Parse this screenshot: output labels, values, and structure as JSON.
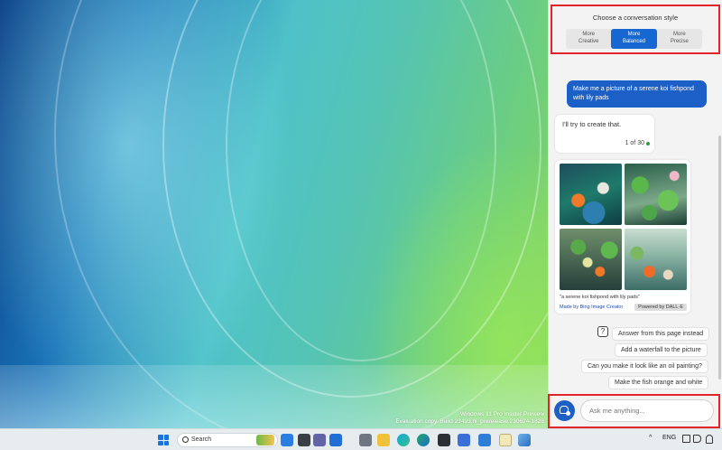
{
  "desktop": {
    "watermark_line1": "Windows 11 Pro Insider Preview",
    "watermark_line2": "Evaluation copy. Build 23493.ni_prerelease.230624-1828"
  },
  "copilot": {
    "style_title": "Choose a conversation style",
    "styles": [
      {
        "line1": "More",
        "line2": "Creative",
        "active": false
      },
      {
        "line1": "More",
        "line2": "Balanced",
        "active": true
      },
      {
        "line1": "More",
        "line2": "Precise",
        "active": false
      }
    ],
    "user_message": "Make me a picture of a serene koi fishpond with lily pads",
    "bot_reply": "I'll try to create that.",
    "turn_counter": "1 of 30",
    "image_card": {
      "caption": "\"a serene koi fishpond with lily pads\"",
      "made_by": "Made by Bing Image Creator",
      "powered_by": "Powered by DALL·E"
    },
    "suggestions": [
      "Answer from this page instead",
      "Add a waterfall to the picture",
      "Can you make it look like an oil painting?",
      "Make the fish orange and white"
    ],
    "input_placeholder": "Ask me anything..."
  },
  "taskbar": {
    "search_label": "Search",
    "language": "ENG",
    "chevron": "^",
    "icons": [
      "start-icon",
      "search-icon",
      "widgets-icon",
      "task-view-icon",
      "teams-icon",
      "chat-icon",
      "settings-icon",
      "file-explorer-icon",
      "edge-icon",
      "edge-dev-icon",
      "terminal-icon",
      "snipping-tool-icon",
      "store-icon",
      "notepad-icon",
      "photos-icon"
    ]
  },
  "colors": {
    "accent": "#1b5fc7",
    "highlight_border": "#e0242a"
  }
}
